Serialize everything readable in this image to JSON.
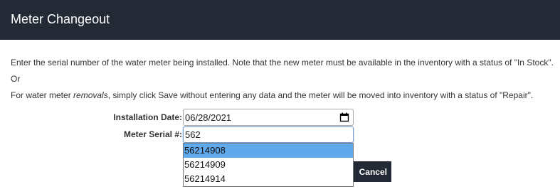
{
  "header": {
    "title": "Meter Changeout"
  },
  "instructions": {
    "line1": "Enter the serial number of the water meter being installed. Note that the new meter must be available in the inventory with a status of \"In Stock\".",
    "line2": "Or",
    "line3_prefix": "For water meter ",
    "line3_emphasis": "removals",
    "line3_suffix": ", simply click Save without entering any data and the meter will be moved into inventory with a status of \"Repair\"."
  },
  "form": {
    "installation_date_label": "Installation Date:",
    "installation_date_value": "06/28/2021",
    "meter_serial_label": "Meter Serial #:",
    "meter_serial_value": "562",
    "calendar_icon": "calendar-icon"
  },
  "autocomplete": {
    "options": [
      {
        "label": "56214908",
        "selected": true
      },
      {
        "label": "56214909",
        "selected": false
      },
      {
        "label": "56214914",
        "selected": false
      }
    ]
  },
  "actions": {
    "cancel_label": "Cancel"
  },
  "colors": {
    "header_bg": "#232a35",
    "highlight": "#5fa9ec",
    "button_bg": "#232a35"
  }
}
